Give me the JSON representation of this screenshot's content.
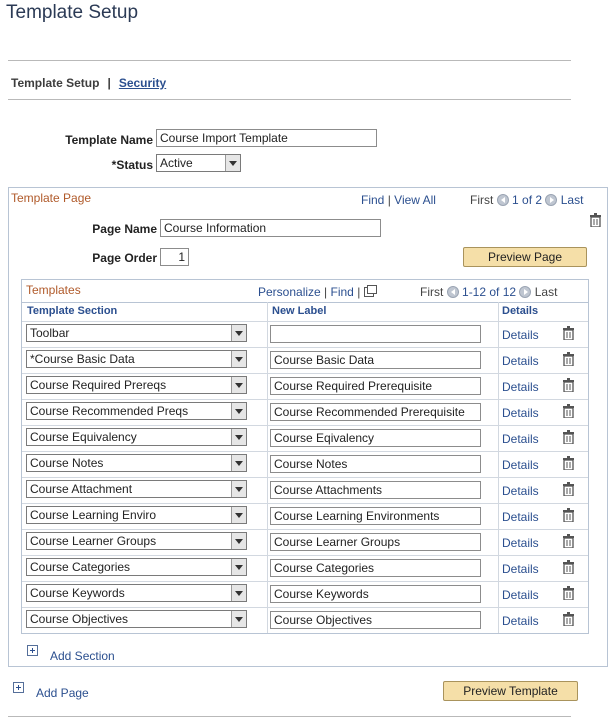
{
  "page": {
    "title": "Template Setup"
  },
  "tabs": {
    "current": "Template Setup",
    "separator": "|",
    "security": "Security"
  },
  "form": {
    "template_name_label": "Template Name",
    "template_name_value": "Course Import Template",
    "status_label": "*Status",
    "status_value": "Active"
  },
  "template_page": {
    "title": "Template Page",
    "find": "Find",
    "pipe": "|",
    "view_all": "View All",
    "first": "First",
    "count": "1 of 2",
    "last": "Last",
    "page_name_label": "Page Name",
    "page_name_value": "Course Information",
    "page_order_label": "Page Order",
    "page_order_value": "1",
    "preview_page": "Preview Page"
  },
  "templates_grid": {
    "title": "Templates",
    "personalize": "Personalize",
    "pipe": "|",
    "find": "Find",
    "first": "First",
    "count": "1-12 of 12",
    "last": "Last",
    "col_section": "Template Section",
    "col_label": "New Label",
    "col_details": "Details",
    "details_link": "Details",
    "rows": [
      {
        "section": "Toolbar",
        "label": ""
      },
      {
        "section": "*Course Basic Data",
        "label": "Course Basic Data"
      },
      {
        "section": "Course Required Prereqs",
        "label": "Course Required Prerequisite"
      },
      {
        "section": "Course Recommended Preqs",
        "label": "Course Recommended Prerequisite"
      },
      {
        "section": "Course Equivalency",
        "label": "Course Eqivalency"
      },
      {
        "section": "Course Notes",
        "label": "Course Notes"
      },
      {
        "section": "Course Attachment",
        "label": "Course Attachments"
      },
      {
        "section": "Course Learning Enviro",
        "label": "Course Learning Environments"
      },
      {
        "section": "Course Learner Groups",
        "label": "Course Learner Groups"
      },
      {
        "section": "Course Categories",
        "label": "Course Categories"
      },
      {
        "section": "Course Keywords",
        "label": "Course Keywords"
      },
      {
        "section": "Course Objectives",
        "label": "Course Objectives"
      }
    ],
    "add_section": "Add Section"
  },
  "footer": {
    "add_page": "Add Page",
    "preview_template": "Preview Template"
  }
}
